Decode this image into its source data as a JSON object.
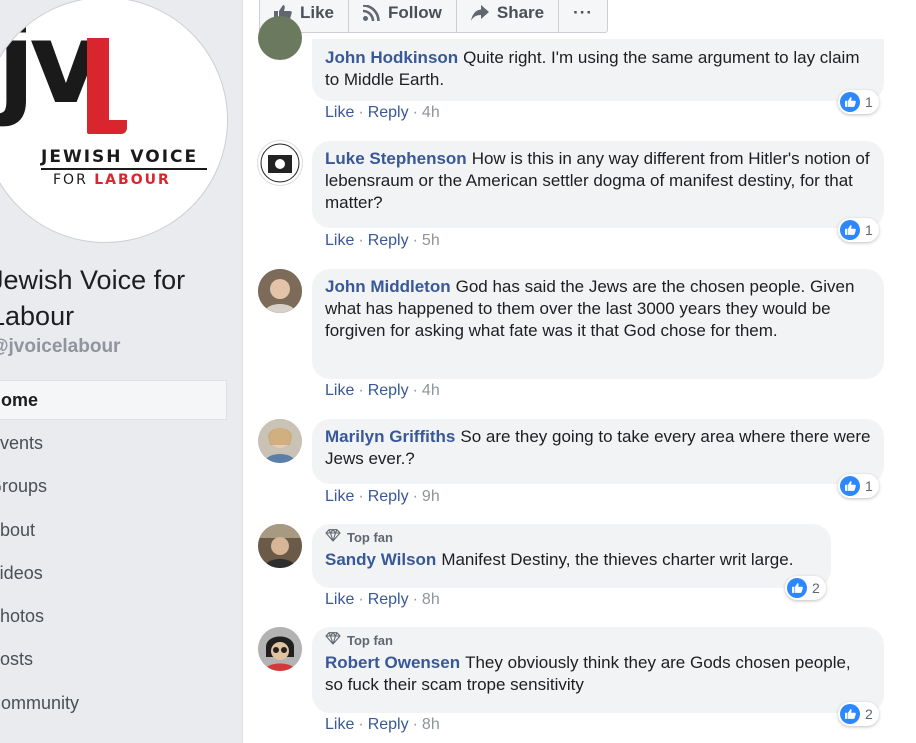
{
  "page": {
    "name": "Jewish Voice for Labour",
    "handle": "@jvoicelabour",
    "logo": {
      "letters": "jv",
      "accent_letter": "l",
      "line1": "JEWISH VOICE",
      "line2_prefix": "FOR",
      "line2_accent": "LABOUR"
    },
    "nav": [
      "Home",
      "Events",
      "Groups",
      "About",
      "Videos",
      "Photos",
      "Posts",
      "Community"
    ],
    "nav_active": "Home"
  },
  "action_bar": {
    "like_label": "Like",
    "follow_label": "Follow",
    "share_label": "Share",
    "more_label": "···"
  },
  "comments": [
    {
      "author": "John Hodkinson",
      "text": "Quite right. I'm using the same argument to lay claim to Middle Earth.",
      "time": "4h",
      "reactions": "1",
      "top_fan": false
    },
    {
      "author": "Luke Stephenson",
      "text": "How is this in any way different from Hitler's notion of lebensraum or the American settler dogma of manifest destiny, for that matter?",
      "time": "5h",
      "reactions": "1",
      "top_fan": false
    },
    {
      "author": "John Middleton",
      "text": "God has said the Jews are the chosen people. Given what has happened to them over the last 3000 years they would be forgiven for asking what fate was it that God chose for them.",
      "time": "4h",
      "reactions": "",
      "top_fan": false
    },
    {
      "author": "Marilyn Griffiths",
      "text": "So are they going to take every area where there were Jews ever.?",
      "time": "9h",
      "reactions": "1",
      "top_fan": false
    },
    {
      "author": "Sandy Wilson",
      "text": "Manifest Destiny, the thieves charter writ large.",
      "time": "8h",
      "reactions": "2",
      "top_fan": true
    },
    {
      "author": "Robert Owensen",
      "text": "They obviously think they are Gods chosen people, so fuck their scam trope sensitivity",
      "time": "8h",
      "reactions": "2",
      "top_fan": true
    }
  ],
  "labels": {
    "like": "Like",
    "reply": "Reply",
    "separator": "·",
    "top_fan": "Top fan"
  },
  "colors": {
    "link": "#385898",
    "bubble": "#f2f3f5",
    "like_blue": "#2d88ff",
    "brand_red": "#d9252e"
  }
}
